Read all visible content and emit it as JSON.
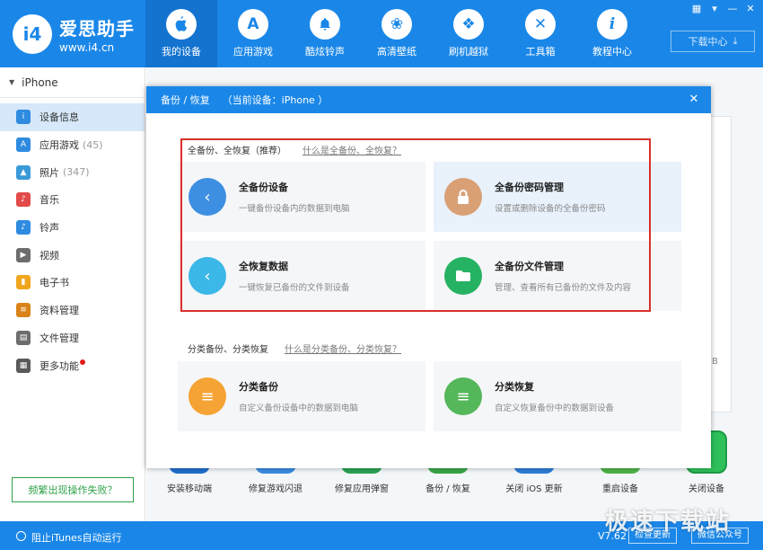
{
  "app": {
    "name": "爱思助手",
    "url": "www.i4.cn",
    "logo_mark": "i4"
  },
  "nav": [
    {
      "label": "我的设备",
      "icon": "apple-icon",
      "glyph": ""
    },
    {
      "label": "应用游戏",
      "icon": "app-store-icon",
      "glyph": "A"
    },
    {
      "label": "酷炫铃声",
      "icon": "bell-icon",
      "glyph": "🔔"
    },
    {
      "label": "高清壁纸",
      "icon": "flower-icon",
      "glyph": "❀"
    },
    {
      "label": "刷机越狱",
      "icon": "box-icon",
      "glyph": "❖"
    },
    {
      "label": "工具箱",
      "icon": "tools-icon",
      "glyph": "✕"
    },
    {
      "label": "教程中心",
      "icon": "info-icon",
      "glyph": "i"
    }
  ],
  "header": {
    "download_label": "下载中心",
    "window_controls": [
      "▦",
      "▾",
      "—",
      "✕"
    ]
  },
  "sidebar": {
    "device": "iPhone",
    "items": [
      {
        "label": "设备信息",
        "count": "",
        "icon": "info-icon",
        "glyph": "i",
        "color": "#2e8be0"
      },
      {
        "label": "应用游戏",
        "count": "(45)",
        "icon": "app-icon",
        "glyph": "A",
        "color": "#2e8be0"
      },
      {
        "label": "照片",
        "count": "(347)",
        "icon": "photo-icon",
        "glyph": "▲",
        "color": "#3a9ad9"
      },
      {
        "label": "音乐",
        "count": "",
        "icon": "music-icon",
        "glyph": "♪",
        "color": "#e24a4a"
      },
      {
        "label": "铃声",
        "count": "",
        "icon": "bell-icon",
        "glyph": "♪",
        "color": "#2e8be0"
      },
      {
        "label": "视频",
        "count": "",
        "icon": "video-icon",
        "glyph": "▶",
        "color": "#6d6d6d"
      },
      {
        "label": "电子书",
        "count": "",
        "icon": "book-icon",
        "glyph": "▮",
        "color": "#f0a51e"
      },
      {
        "label": "资料管理",
        "count": "",
        "icon": "contacts-icon",
        "glyph": "≡",
        "color": "#d9831a"
      },
      {
        "label": "文件管理",
        "count": "",
        "icon": "file-icon",
        "glyph": "▤",
        "color": "#6d6d6d"
      },
      {
        "label": "更多功能",
        "count": "",
        "icon": "more-icon",
        "glyph": "▦",
        "color": "#5a5a5a"
      }
    ],
    "fail_button": "频繁出现操作失败？"
  },
  "background": {
    "gb_fragment": "B",
    "tools": [
      {
        "label": "安装移动端",
        "color": "#1f6fd0"
      },
      {
        "label": "修复游戏闪退",
        "color": "#3a8de3"
      },
      {
        "label": "修复应用弹窗",
        "color": "#2aa454"
      },
      {
        "label": "备份 / 恢复",
        "color": "#3aa74a"
      },
      {
        "label": "关闭 iOS 更新",
        "color": "#2b7fd8"
      },
      {
        "label": "重启设备",
        "color": "#4fb548"
      },
      {
        "label": "关闭设备",
        "color": "#2ec05a"
      }
    ]
  },
  "status": {
    "itunes_label": "阻止iTunes自动运行",
    "version": "V7.62",
    "check_update": "检查更新",
    "wechat": "微信公众号"
  },
  "dialog": {
    "title": "备份 / 恢复    （当前设备：iPhone ）",
    "close": "✕",
    "full_section": {
      "title": "全备份、全恢复（推荐）",
      "link": "什么是全备份、全恢复？",
      "cards": [
        {
          "title": "全备份设备",
          "desc": "一键备份设备内的数据到电脑",
          "icon": "backup-icon",
          "glyph": "‹",
          "color": "#3d8fe2"
        },
        {
          "title": "全备份密码管理",
          "desc": "设置或删除设备的全备份密码",
          "icon": "lock-icon",
          "glyph": "🔒",
          "color": "#d9a076"
        },
        {
          "title": "全恢复数据",
          "desc": "一键恢复已备份的文件到设备",
          "icon": "restore-icon",
          "glyph": "‹",
          "color": "#3bb7e8"
        },
        {
          "title": "全备份文件管理",
          "desc": "管理、查看所有已备份的文件及内容",
          "icon": "folder-icon",
          "glyph": "▬",
          "color": "#26b263"
        }
      ]
    },
    "class_section": {
      "title": "分类备份、分类恢复",
      "link": "什么是分类备份、分类恢复？",
      "cards": [
        {
          "title": "分类备份",
          "desc": "自定义备份设备中的数据到电脑",
          "icon": "class-backup-icon",
          "glyph": "≡",
          "color": "#f5a334"
        },
        {
          "title": "分类恢复",
          "desc": "自定义恢复备份中的数据到设备",
          "icon": "class-restore-icon",
          "glyph": "≡",
          "color": "#54b75a"
        }
      ]
    }
  },
  "watermark": "极速下载站"
}
